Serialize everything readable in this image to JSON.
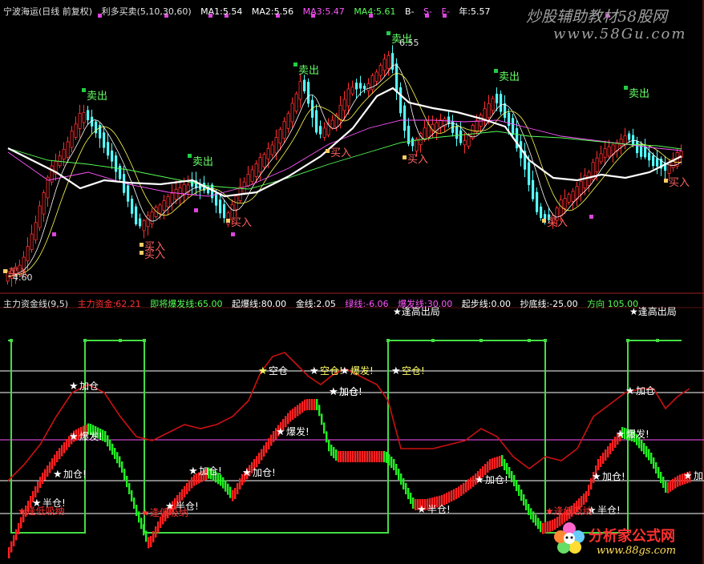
{
  "top_panel": {
    "stock": "宁波海运(日线 前复权)",
    "indicator": "利多买卖(5,10,30,60)",
    "ma1": "MA1:5.54",
    "ma2": "MA2:5.56",
    "ma3": "MA3:5.47",
    "ma4": "MA4:5.61",
    "b": "B-",
    "s": "S-",
    "f": "F-",
    "year": "年:5.57",
    "high_label": "6.55",
    "low_label": "4.60",
    "colors": {
      "up": "#ff3030",
      "down": "#54ffff",
      "ma1": "#ffffff",
      "ma2": "#ffff55",
      "ma3": "#ff55ff",
      "ma4": "#55ff55",
      "year": "#ffffff"
    }
  },
  "bottom_panel": {
    "indicator": "主力资金线(9,5)",
    "main_fund": "主力资金:62.21",
    "imminent": "即将爆发线:65.00",
    "ignite": "起爆线:80.00",
    "gold": "金线:2.05",
    "green": "绿线:-6.06",
    "burst": "爆发线:30.00",
    "start": "起步线:0.00",
    "bottom_fish": "抄底线:-25.00",
    "direction": "方向 105.00",
    "colors": {
      "fund": "#cc1111",
      "green_line": "#44dd44",
      "bar_up": "#ff2020",
      "bar_down": "#22ee22",
      "level": "#ffffff"
    }
  },
  "signals_top": {
    "sell": [
      "卖出",
      "卖出",
      "卖出",
      "卖出",
      "卖出",
      "卖出"
    ],
    "buy": [
      "买入",
      "买入",
      "买入",
      "买入",
      "买入",
      "买入",
      "买入",
      "买入"
    ]
  },
  "signals_bottom": {
    "labels": [
      "加仓",
      "爆发!",
      "加仓!",
      "半仓!",
      "半仓!",
      "加仓!",
      "加仓!",
      "爆发!",
      "加仓!",
      "空仓!",
      "爆发!",
      "加仓",
      "空仓!",
      "半仓!",
      "加仓!",
      "加仓",
      "爆发!",
      "加仓!",
      "半仓!",
      "加"
    ],
    "clipped_top": [
      "逢高出局",
      "逢高出局",
      "逢高出局"
    ],
    "clipped_bottom": [
      "逢低吸纳",
      "逢低吸纳",
      "逢低吸纳"
    ]
  },
  "watermark": {
    "site1": "炒股辅助教材58股网",
    "url1": "www.58Gu.com",
    "site2": "分析家公式网",
    "url2": "www.88gs.com"
  },
  "chart_data": [
    {
      "type": "candlestick",
      "title": "宁波海运(日线 前复权)",
      "indicator_title": "利多买卖(5,10,30,60)",
      "price_range": [
        4.6,
        6.55
      ],
      "series": [
        {
          "name": "MA1",
          "last": 5.54
        },
        {
          "name": "MA2",
          "last": 5.56
        },
        {
          "name": "MA3",
          "last": 5.47
        },
        {
          "name": "MA4",
          "last": 5.61
        },
        {
          "name": "年",
          "last": 5.57
        }
      ],
      "annotations": [
        "6.55",
        "4.60"
      ]
    },
    {
      "type": "line",
      "title": "主力资金线(9,5)",
      "levels": [
        {
          "name": "即将爆发线",
          "value": 65.0
        },
        {
          "name": "起爆线",
          "value": 80.0
        },
        {
          "name": "爆发线",
          "value": 30.0
        },
        {
          "name": "起步线",
          "value": 0.0
        },
        {
          "name": "抄底线",
          "value": -25.0
        },
        {
          "name": "方向",
          "value": 105.0
        }
      ],
      "series": [
        {
          "name": "主力资金",
          "last": 62.21
        },
        {
          "name": "金线",
          "last": 2.05
        },
        {
          "name": "绿线",
          "last": -6.06
        }
      ]
    }
  ]
}
